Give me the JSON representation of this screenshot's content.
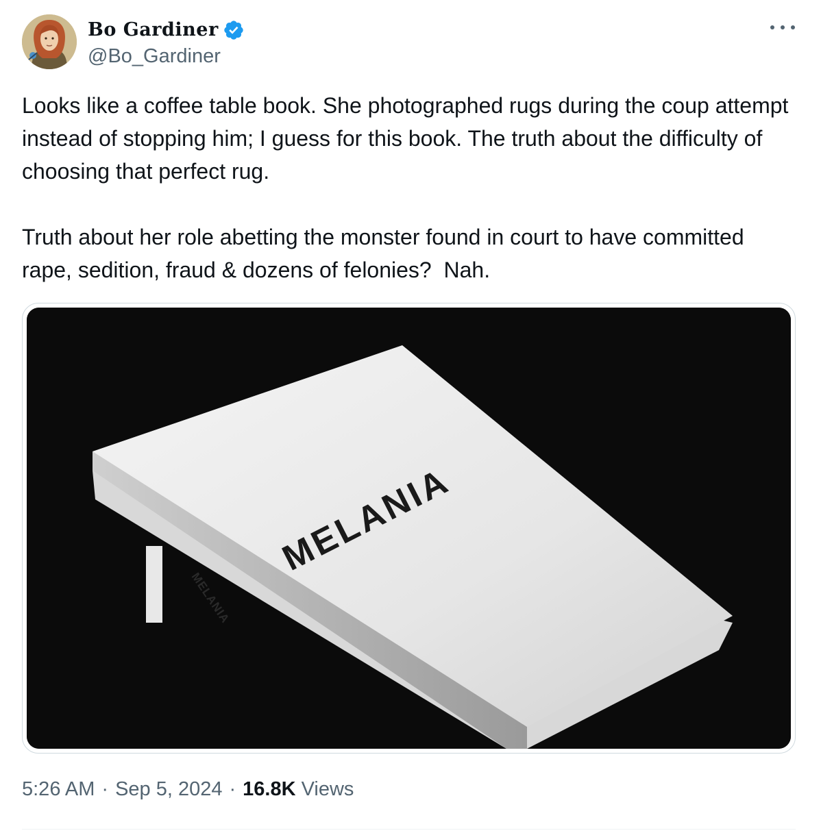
{
  "author": {
    "display_name": "Bo Gardiner",
    "handle": "@Bo_Gardiner",
    "verified": true,
    "verified_color": "#1d9bf0",
    "avatar_icon": "portrait-avatar"
  },
  "more_icon": "ellipsis-icon",
  "tweet": {
    "text": "Looks like a coffee table book. She photographed rugs during the coup attempt instead of stopping him; I guess for this book. The truth about the difficulty of choosing that perfect rug.\n\nTruth about her role abetting the monster found in court to have committed rape, sedition, fraud & dozens of felonies?  Nah."
  },
  "media": {
    "cover_title": "MELANIA",
    "spine_title": "MELANIA"
  },
  "meta": {
    "time": "5:26 AM",
    "separator": "·",
    "date": "Sep 5, 2024",
    "views_count": "16.8K",
    "views_label": "Views"
  }
}
